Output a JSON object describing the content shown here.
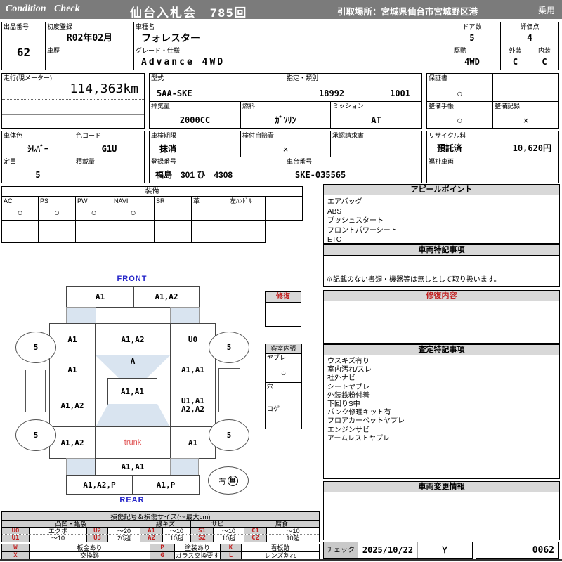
{
  "header": {
    "brand": "Condition Check",
    "title": "仙台入札会　785回",
    "pickup": "引取場所：宮城県仙台市宮城野区港",
    "usage": "乗用"
  },
  "lot": {
    "label": "出品番号",
    "value": "62"
  },
  "first_reg": {
    "label": "初度登録",
    "value": "R02年02月"
  },
  "model": {
    "label": "車種名",
    "value": "フォレスター"
  },
  "doors": {
    "label": "ドア数",
    "value": "5"
  },
  "score": {
    "label": "評価点",
    "value": "4"
  },
  "history": {
    "label": "車歴",
    "value": ""
  },
  "grade": {
    "label": "グレード・仕様",
    "value": "Advance 4WD"
  },
  "drive": {
    "label": "駆動",
    "value": "4WD"
  },
  "exterior": {
    "label": "外装",
    "value": "C"
  },
  "interior": {
    "label": "内装",
    "value": "C"
  },
  "meter": {
    "label": "走行(現メーター)",
    "value": "114,363km"
  },
  "model_code": {
    "label": "型式",
    "value": "5AA-SKE"
  },
  "class_no": {
    "label": "指定・類別",
    "value1": "18992",
    "value2": "1001"
  },
  "displacement": {
    "label": "排気量",
    "value": "2000CC"
  },
  "fuel": {
    "label": "燃料",
    "value": "ｶﾞｿﾘﾝ"
  },
  "transmission": {
    "label": "ミッション",
    "value": "AT"
  },
  "warranty": {
    "label": "保証書",
    "value": "○"
  },
  "service_book": {
    "label": "整備手帳",
    "value": "○"
  },
  "service_record": {
    "label": "整備記録",
    "value": "×"
  },
  "body_color": {
    "label": "車体色",
    "value": "ｼﾙﾊﾞｰ"
  },
  "color_code": {
    "label": "色コード",
    "value": "G1U"
  },
  "inspection": {
    "label": "車検期限",
    "value": "抹消"
  },
  "insurance": {
    "label": "検付自賠責",
    "value": "×"
  },
  "approval": {
    "label": "承認請求書",
    "value": ""
  },
  "recycle": {
    "label": "リサイクル料",
    "status": "預託済",
    "fee": "10,620円"
  },
  "capacity": {
    "label": "定員",
    "value": "5"
  },
  "load": {
    "label": "積載量",
    "value": ""
  },
  "plate": {
    "label": "登録番号",
    "value": "福島　301 ひ　4308"
  },
  "chassis": {
    "label": "車台番号",
    "value": "SKE-035565"
  },
  "welfare": {
    "label": "福祉車両",
    "value": ""
  },
  "equipment": {
    "title": "装備",
    "items": [
      {
        "label": "AC",
        "value": "○"
      },
      {
        "label": "PS",
        "value": "○"
      },
      {
        "label": "PW",
        "value": "○"
      },
      {
        "label": "NAVI",
        "value": "○"
      },
      {
        "label": "SR",
        "value": ""
      },
      {
        "label": "革",
        "value": ""
      },
      {
        "label": "左ﾊﾝﾄﾞﾙ",
        "value": ""
      },
      {
        "label": "",
        "value": ""
      }
    ]
  },
  "appeal": {
    "title": "アピールポイント",
    "items": [
      "エアバッグ",
      "ABS",
      "プッシュスタート",
      "フロントパワーシート",
      "ETC"
    ]
  },
  "vehicle_notes": {
    "title": "車両特記事項",
    "note": "※記載のない書類・機器等は無しとして取り扱います。"
  },
  "repair_content": {
    "title": "修復内容"
  },
  "assessment": {
    "title": "査定特記事項",
    "items": [
      "ウスキズ有り",
      "室内汚れ/スレ",
      "社外ナビ",
      "シートヤブレ",
      "外装鉄粉付着",
      "下回りS中",
      "パンク修理キット有",
      "フロアカーペットヤブレ",
      "エンジンサビ",
      "アームレストヤブレ"
    ]
  },
  "change_info": {
    "title": "車両変更情報"
  },
  "check": {
    "label": "チェック",
    "date": "2025/10/22",
    "inspector": "Ｙ",
    "number": "0062"
  },
  "diagram": {
    "front_label": "FRONT",
    "rear_label": "REAR",
    "front_bumper_l": "A1",
    "front_bumper_r": "A1,A2",
    "fender_fl": "A1",
    "hood": "A1,A2",
    "fender_fr": "U0",
    "door_fl": "A1",
    "windshield": "A",
    "door_fr": "A1,A1",
    "roof": "A1,A1",
    "door_rl": "A1,A2",
    "door_rr_1": "U1,A1",
    "door_rr_2": "A2,A2",
    "quarter_l": "A1,A2",
    "trunk": "trunk",
    "quarter_r": "A1",
    "rear_panel": "A1,A1",
    "rear_bumper_l": "A1,A2,P",
    "rear_bumper_r": "A1,P",
    "wheel_fl": "5",
    "wheel_fr": "5",
    "wheel_rl": "5",
    "wheel_rr": "5",
    "repair_flag": {
      "title": "修復"
    },
    "cabin": {
      "title": "客室内張",
      "rows": [
        {
          "label": "ヤブレ",
          "value": "○"
        },
        {
          "label": "穴",
          "value": ""
        },
        {
          "label": "コゲ",
          "value": ""
        }
      ]
    },
    "accident": {
      "yes": "有",
      "no": "無"
    }
  },
  "legend": {
    "title": "損傷記号＆損傷サイズ(〜最大cm)",
    "groups": [
      "凸凹・亀裂",
      "線キズ",
      "サビ",
      "腐食"
    ],
    "size_rows": [
      [
        "U0",
        "エクボ",
        "U2",
        "〜20",
        "A1",
        "〜10",
        "S1",
        "〜10",
        "C1",
        "〜10"
      ],
      [
        "U1",
        "〜10",
        "U3",
        "20超",
        "A2",
        "10超",
        "S2",
        "10超",
        "C2",
        "10超"
      ]
    ],
    "mark_rows": [
      [
        "W",
        "板金あり",
        "P",
        "塗装あり",
        "K",
        "看板跡"
      ],
      [
        "X",
        "交換跡",
        "G",
        "ガラス交換要す",
        "L",
        "レンズ割れ"
      ]
    ]
  }
}
